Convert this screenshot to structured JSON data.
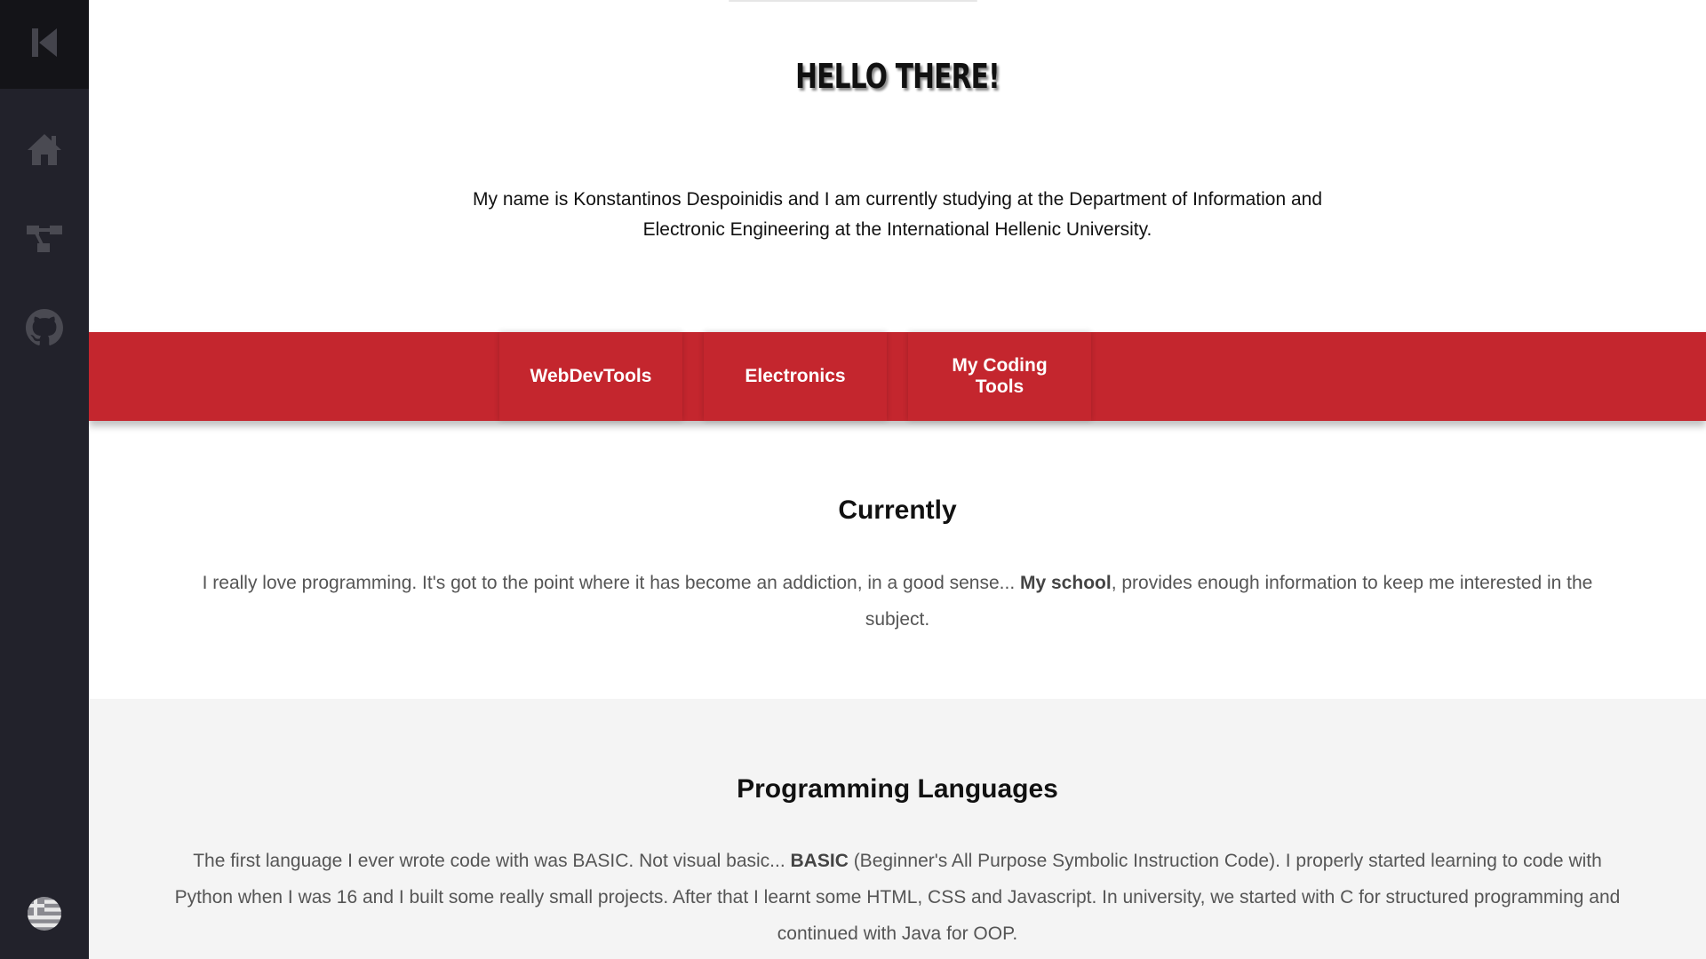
{
  "sidebar": {
    "collapse_icon": "collapse-left-icon",
    "items": [
      {
        "icon": "home-icon"
      },
      {
        "icon": "projects-tree-icon"
      },
      {
        "icon": "github-icon"
      }
    ],
    "language_icon": "greek-flag-icon"
  },
  "hero": {
    "title": "HELLO THERE!",
    "text": "My name is Konstantinos Despoinidis and I am currently studying at the Department of Information and Electronic Engineering at the International Hellenic University."
  },
  "nav_band": {
    "color": "#c4262e",
    "buttons": [
      {
        "label": "WebDevTools"
      },
      {
        "label": "Electronics"
      },
      {
        "label": "My Coding Tools"
      }
    ]
  },
  "currently": {
    "title": "Currently",
    "text_before": "I really love programming. It's got to the point where it has become an addiction, in a good sense... ",
    "text_bold": "My school",
    "text_after": ", provides enough information to keep me interested in the subject."
  },
  "languages": {
    "title": "Programming Languages",
    "text_before": "The first language I ever wrote code with was BASIC. Not visual basic... ",
    "text_bold": "BASIC",
    "text_after": " (Beginner's All Purpose Symbolic Instruction Code). I properly started learning to code with Python when I was 16 and I built some really small projects. After that I learnt some HTML, CSS and Javascript. In university, we started with C for structured programming and continued with Java for OOP."
  }
}
